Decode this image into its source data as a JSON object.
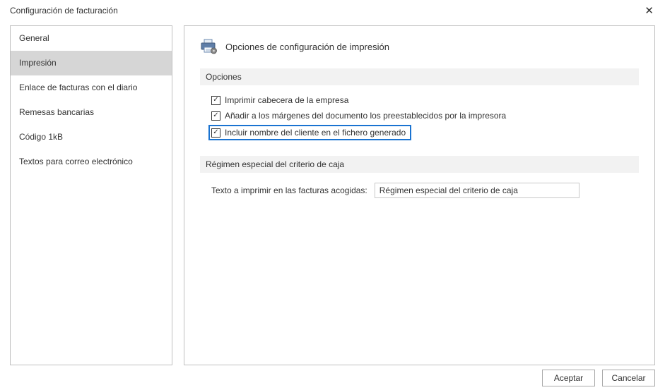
{
  "window": {
    "title": "Configuración de facturación",
    "close_symbol": "✕"
  },
  "sidebar": {
    "items": [
      {
        "label": "General",
        "selected": false
      },
      {
        "label": "Impresión",
        "selected": true
      },
      {
        "label": "Enlace de facturas con el diario",
        "selected": false
      },
      {
        "label": "Remesas bancarias",
        "selected": false
      },
      {
        "label": "Código 1kB",
        "selected": false
      },
      {
        "label": "Textos para correo electrónico",
        "selected": false
      }
    ]
  },
  "panel": {
    "title": "Opciones de configuración de impresión",
    "sections": {
      "opciones": {
        "header": "Opciones",
        "items": [
          {
            "label": "Imprimir cabecera de la empresa",
            "checked": true,
            "highlight": false
          },
          {
            "label": "Añadir a los márgenes del documento los preestablecidos por la impresora",
            "checked": true,
            "highlight": false
          },
          {
            "label": "Incluir nombre del cliente en el fichero generado",
            "checked": true,
            "highlight": true
          }
        ]
      },
      "regimen": {
        "header": "Régimen especial del criterio de caja",
        "field_label": "Texto a imprimir en las facturas acogidas:",
        "field_value": "Régimen especial del criterio de caja"
      }
    }
  },
  "buttons": {
    "accept": "Aceptar",
    "cancel": "Cancelar"
  }
}
